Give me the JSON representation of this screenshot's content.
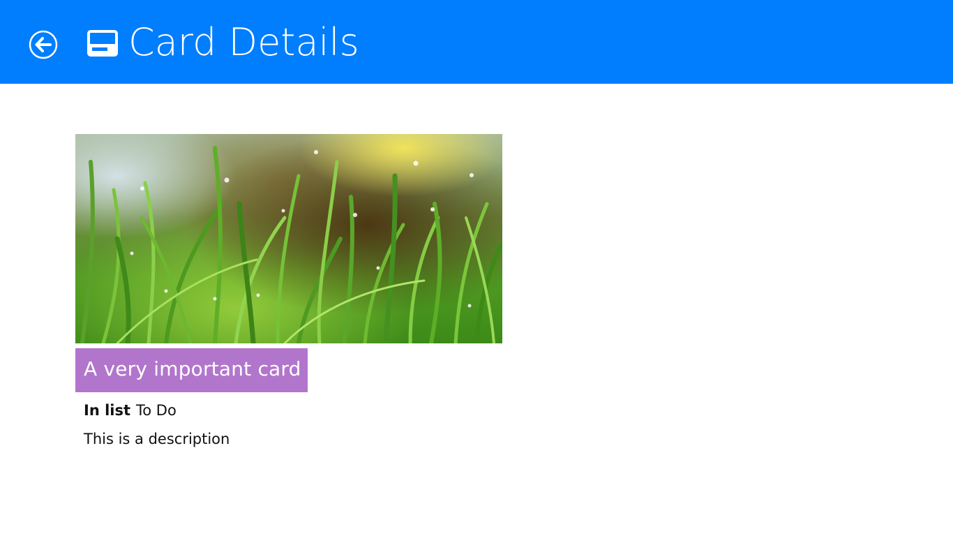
{
  "header": {
    "title": "Card Details",
    "back_icon": "back-arrow-circle-icon",
    "title_icon": "card-icon",
    "background_color": "#007efe"
  },
  "card": {
    "image_description_icon": "grass-photo",
    "title": "A very important card",
    "title_background_color": "#b176cc",
    "list_label": "In list",
    "list_value": "To Do",
    "description": "This is a description"
  }
}
